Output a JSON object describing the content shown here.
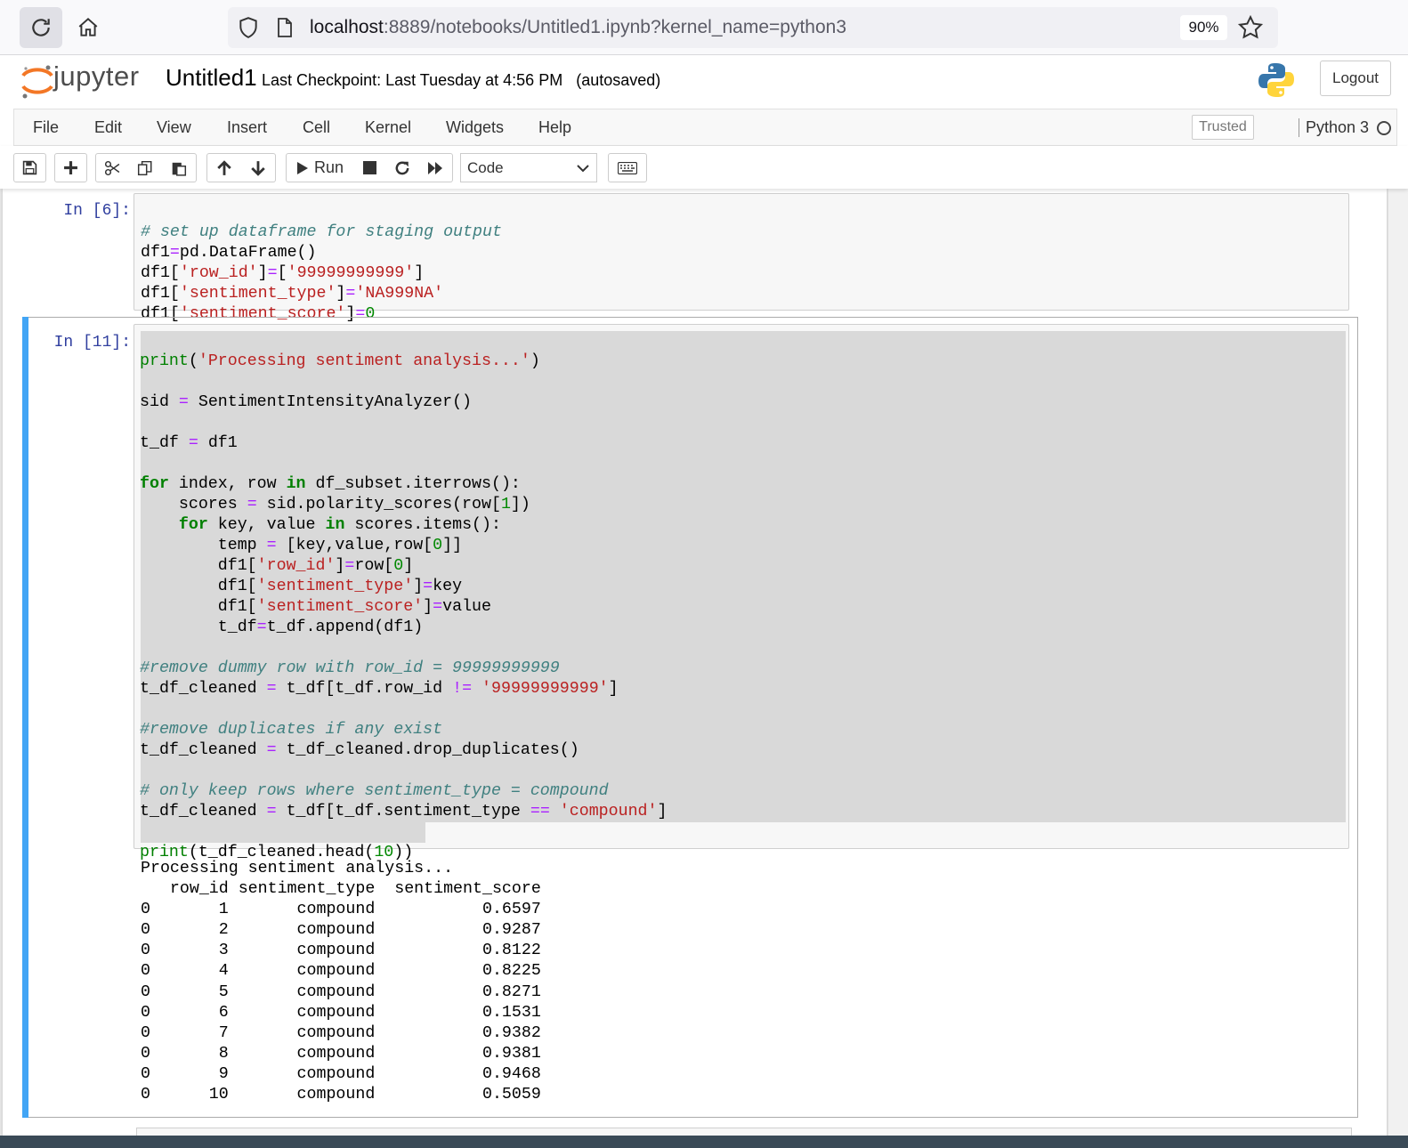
{
  "browser": {
    "url_host": "localhost",
    "url_rest": ":8889/notebooks/Untitled1.ipynb?kernel_name=python3",
    "zoom": "90%"
  },
  "header": {
    "logo_text": "jupyter",
    "notebook_title": "Untitled1",
    "checkpoint": "Last Checkpoint: Last Tuesday at 4:56 PM",
    "autosave": "(autosaved)",
    "logout_label": "Logout"
  },
  "menubar": {
    "items": [
      "File",
      "Edit",
      "View",
      "Insert",
      "Cell",
      "Kernel",
      "Widgets",
      "Help"
    ],
    "trusted": "Trusted",
    "kernel": "Python 3"
  },
  "toolbar": {
    "run_label": "Run",
    "cell_type": "Code"
  },
  "cells": [
    {
      "prompt": "In [6]:",
      "code": [
        "# set up dataframe for staging output",
        "df1=pd.DataFrame()",
        "df1['row_id']=['99999999999']",
        "df1['sentiment_type']='NA999NA'",
        "df1['sentiment_score']=0"
      ]
    },
    {
      "prompt": "In [11]:",
      "code": [
        "print('Processing sentiment analysis...')",
        "",
        "sid = SentimentIntensityAnalyzer()",
        "",
        "t_df = df1",
        "",
        "for index, row in df_subset.iterrows():",
        "    scores = sid.polarity_scores(row[1])",
        "    for key, value in scores.items():",
        "        temp = [key,value,row[0]]",
        "        df1['row_id']=row[0]",
        "        df1['sentiment_type']=key",
        "        df1['sentiment_score']=value",
        "        t_df=t_df.append(df1)",
        "",
        "#remove dummy row with row_id = 99999999999",
        "t_df_cleaned = t_df[t_df.row_id != '99999999999']",
        "",
        "#remove duplicates if any exist",
        "t_df_cleaned = t_df_cleaned.drop_duplicates()",
        "",
        "# only keep rows where sentiment_type = compound",
        "t_df_cleaned = t_df[t_df.sentiment_type == 'compound']",
        "",
        "print(t_df_cleaned.head(10))"
      ],
      "output": {
        "line1": "Processing sentiment analysis...",
        "columns": [
          "row_id",
          "sentiment_type",
          "sentiment_score"
        ],
        "rows": [
          [
            "0",
            "1",
            "compound",
            "0.6597"
          ],
          [
            "0",
            "2",
            "compound",
            "0.9287"
          ],
          [
            "0",
            "3",
            "compound",
            "0.8122"
          ],
          [
            "0",
            "4",
            "compound",
            "0.8225"
          ],
          [
            "0",
            "5",
            "compound",
            "0.8271"
          ],
          [
            "0",
            "6",
            "compound",
            "0.1531"
          ],
          [
            "0",
            "7",
            "compound",
            "0.9382"
          ],
          [
            "0",
            "8",
            "compound",
            "0.9381"
          ],
          [
            "0",
            "9",
            "compound",
            "0.9468"
          ],
          [
            "0",
            "10",
            "compound",
            "0.5059"
          ]
        ]
      }
    }
  ],
  "colors": {
    "selected_bar": "#42a5f5",
    "prompt": "#303f9f",
    "comment": "#408080",
    "string": "#ba2121",
    "keyword": "#008000"
  }
}
